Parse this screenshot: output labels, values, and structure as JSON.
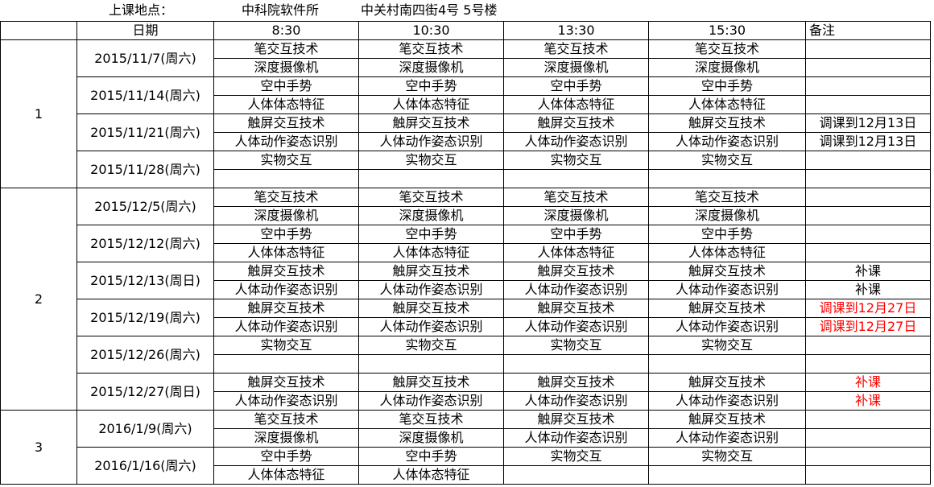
{
  "header": {
    "location_label": "上课地点：",
    "location_name": "中科院软件所",
    "address": "中关村南四街4号  5号楼"
  },
  "columns": {
    "date": "日期",
    "t1": "8:30",
    "t2": "10:30",
    "t3": "13:30",
    "t4": "15:30",
    "note": "备注"
  },
  "groups": [
    {
      "label": "1"
    },
    {
      "label": "2"
    },
    {
      "label": "3"
    }
  ],
  "rows": [
    {
      "date": "2015/11/7(周六)",
      "r1": [
        "笔交互技术",
        "笔交互技术",
        "笔交互技术",
        "笔交互技术",
        ""
      ],
      "r2": [
        "深度摄像机",
        "深度摄像机",
        "深度摄像机",
        "深度摄像机",
        ""
      ]
    },
    {
      "date": "2015/11/14(周六)",
      "r1": [
        "空中手势",
        "空中手势",
        "空中手势",
        "空中手势",
        ""
      ],
      "r2": [
        "人体体态特征",
        "人体体态特征",
        "人体体态特征",
        "人体体态特征",
        ""
      ]
    },
    {
      "date": "2015/11/21(周六)",
      "r1": [
        "触屏交互技术",
        "触屏交互技术",
        "触屏交互技术",
        "触屏交互技术",
        "调课到12月13日"
      ],
      "r2": [
        "人体动作姿态识别",
        "人体动作姿态识别",
        "人体动作姿态识别",
        "人体动作姿态识别",
        "调课到12月13日"
      ]
    },
    {
      "date": "2015/11/28(周六)",
      "r1": [
        "实物交互",
        "实物交互",
        "实物交互",
        "实物交互",
        ""
      ],
      "r2": [
        "",
        "",
        "",
        "",
        ""
      ]
    },
    {
      "date": "2015/12/5(周六)",
      "r1": [
        "笔交互技术",
        "笔交互技术",
        "笔交互技术",
        "笔交互技术",
        ""
      ],
      "r2": [
        "深度摄像机",
        "深度摄像机",
        "深度摄像机",
        "深度摄像机",
        ""
      ]
    },
    {
      "date": "2015/12/12(周六)",
      "r1": [
        "空中手势",
        "空中手势",
        "空中手势",
        "空中手势",
        ""
      ],
      "r2": [
        "人体体态特征",
        "人体体态特征",
        "人体体态特征",
        "人体体态特征",
        ""
      ]
    },
    {
      "date": "2015/12/13(周日)",
      "r1": [
        "触屏交互技术",
        "触屏交互技术",
        "触屏交互技术",
        "触屏交互技术",
        "补课"
      ],
      "r2": [
        "人体动作姿态识别",
        "人体动作姿态识别",
        "人体动作姿态识别",
        "人体动作姿态识别",
        "补课"
      ]
    },
    {
      "date": "2015/12/19(周六)",
      "r1": [
        "触屏交互技术",
        "触屏交互技术",
        "触屏交互技术",
        "触屏交互技术",
        "调课到12月27日"
      ],
      "r2": [
        "人体动作姿态识别",
        "人体动作姿态识别",
        "人体动作姿态识别",
        "人体动作姿态识别",
        "调课到12月27日"
      ],
      "note_color": "#ff0000"
    },
    {
      "date": "2015/12/26(周六)",
      "r1": [
        "实物交互",
        "实物交互",
        "实物交互",
        "实物交互",
        ""
      ],
      "r2": [
        "",
        "",
        "",
        "",
        ""
      ]
    },
    {
      "date": "2015/12/27(周日)",
      "r1": [
        "触屏交互技术",
        "触屏交互技术",
        "触屏交互技术",
        "触屏交互技术",
        "补课"
      ],
      "r2": [
        "人体动作姿态识别",
        "人体动作姿态识别",
        "人体动作姿态识别",
        "人体动作姿态识别",
        "补课"
      ],
      "note_color": "#ff0000"
    },
    {
      "date": "2016/1/9(周六)",
      "r1": [
        "笔交互技术",
        "笔交互技术",
        "触屏交互技术",
        "触屏交互技术",
        ""
      ],
      "r2": [
        "深度摄像机",
        "深度摄像机",
        "人体动作姿态识别",
        "人体动作姿态识别",
        ""
      ]
    },
    {
      "date": "2016/1/16(周六)",
      "r1": [
        "空中手势",
        "空中手势",
        "实物交互",
        "实物交互",
        ""
      ],
      "r2": [
        "人体体态特征",
        "人体体态特征",
        "",
        "",
        ""
      ]
    }
  ]
}
